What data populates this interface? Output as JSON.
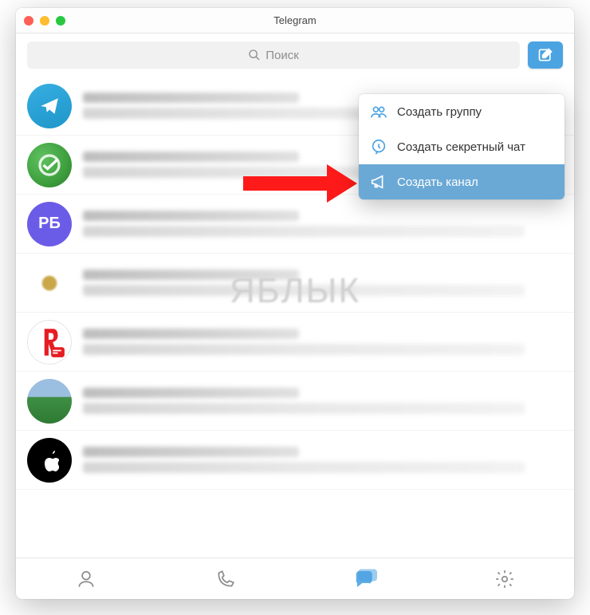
{
  "window": {
    "title": "Telegram"
  },
  "search": {
    "placeholder": "Поиск"
  },
  "chats": [
    {
      "avatar_type": "telegram",
      "avatar_text": ""
    },
    {
      "avatar_type": "sber",
      "avatar_text": ""
    },
    {
      "avatar_type": "rb",
      "avatar_text": "РБ"
    },
    {
      "avatar_type": "eagle",
      "avatar_text": ""
    },
    {
      "avatar_type": "ya",
      "avatar_text": ""
    },
    {
      "avatar_type": "field",
      "avatar_text": ""
    },
    {
      "avatar_type": "apple",
      "avatar_text": ""
    }
  ],
  "compose_menu": {
    "items": [
      {
        "icon": "group",
        "label": "Создать группу",
        "selected": false
      },
      {
        "icon": "secret",
        "label": "Создать секретный чат",
        "selected": false
      },
      {
        "icon": "channel",
        "label": "Создать канал",
        "selected": true
      }
    ]
  },
  "tabs": {
    "contacts_active": false,
    "calls_active": false,
    "chats_active": true,
    "settings_active": false
  },
  "watermark": "ЯБЛЫК",
  "colors": {
    "accent": "#4ba3e2",
    "menu_highlight": "#6aa9d6",
    "arrow": "#ff1a1a"
  }
}
